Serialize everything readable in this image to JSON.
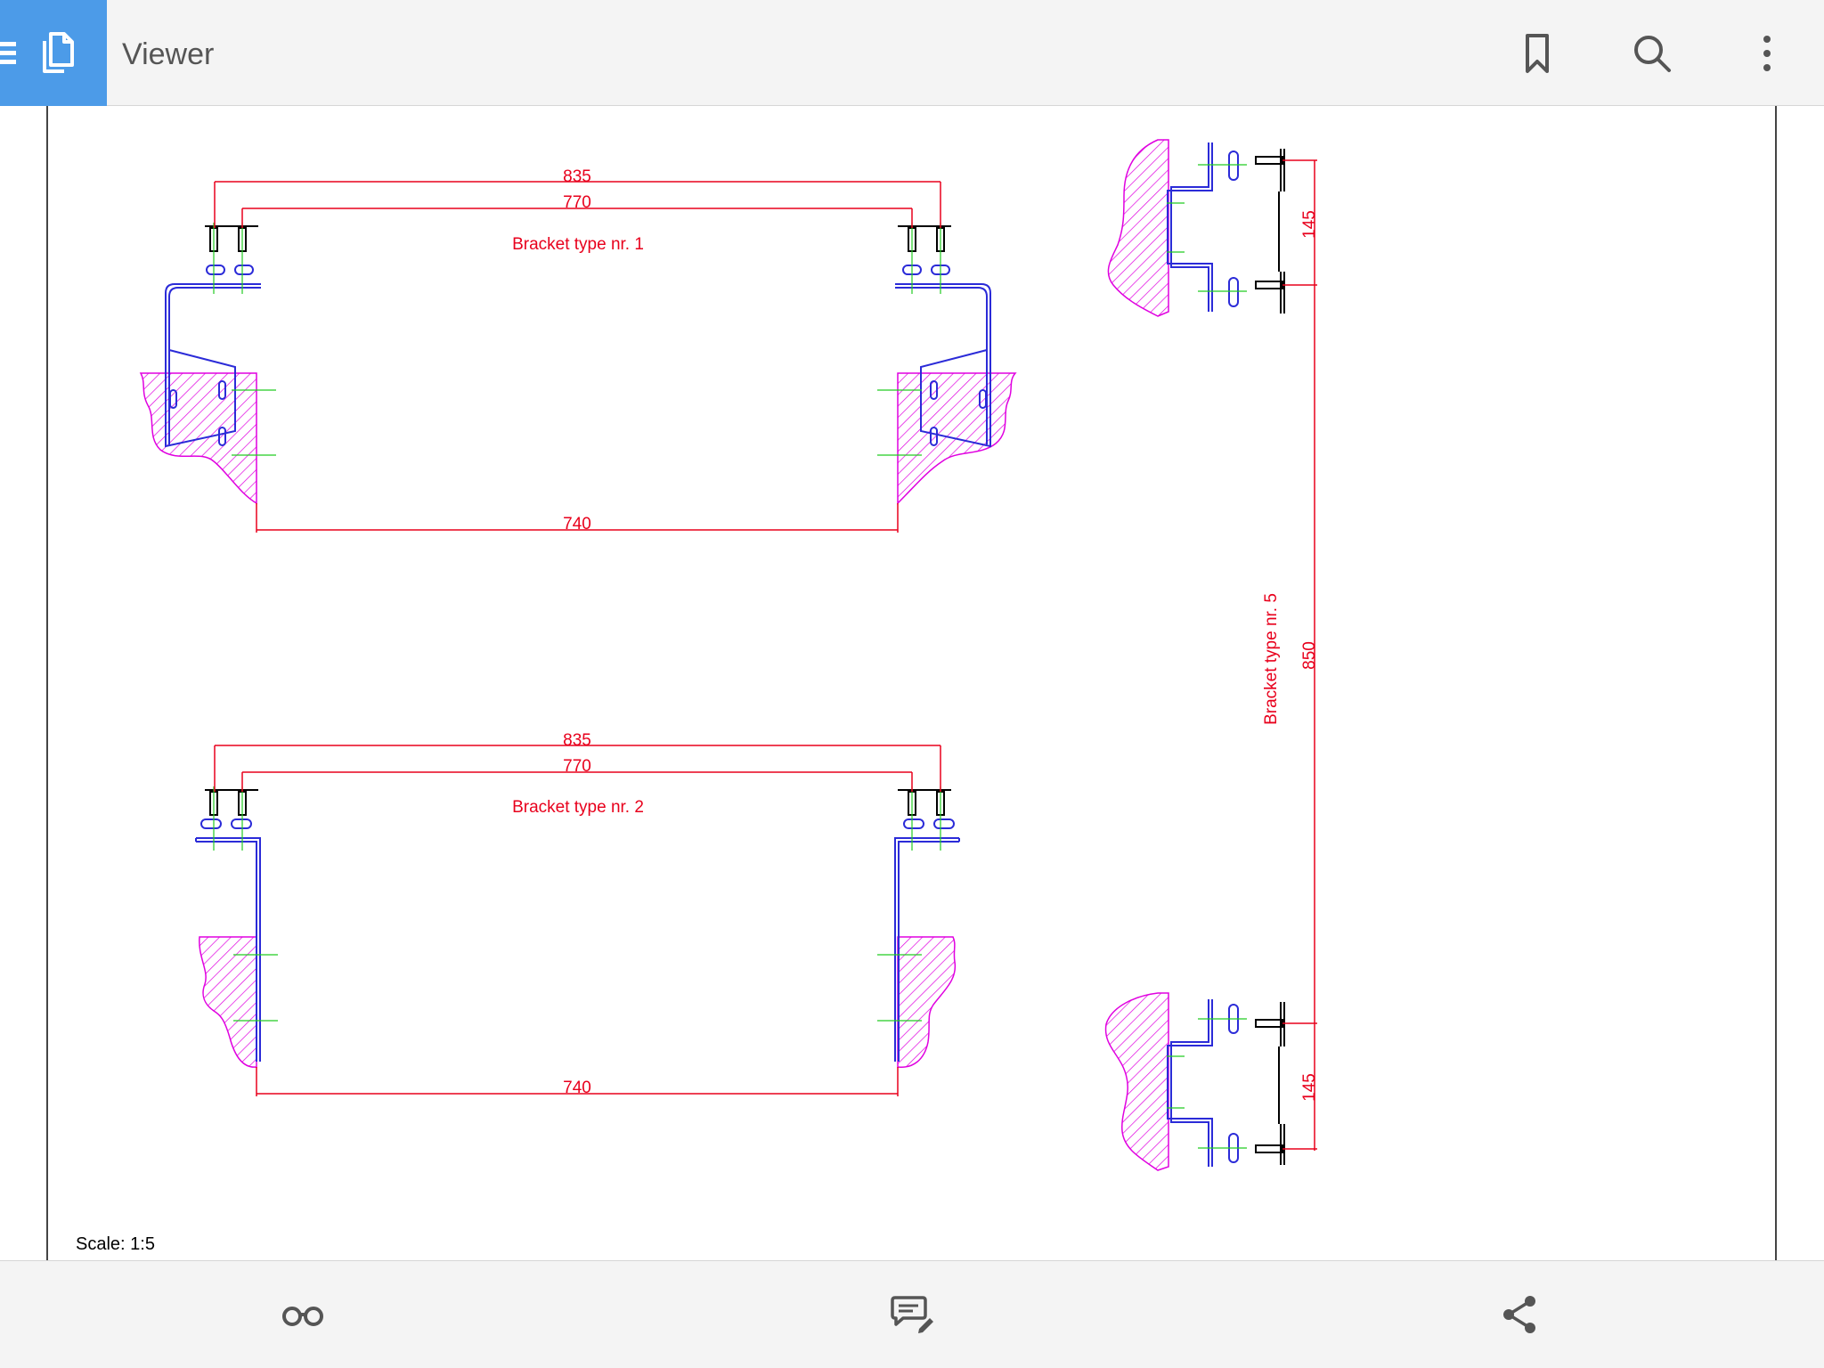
{
  "app": {
    "title": "Viewer"
  },
  "toolbar": {
    "menu_icon": "hamburger-icon",
    "doc_icon": "documents-icon",
    "bookmark_icon": "bookmark-icon",
    "search_icon": "search-icon",
    "more_icon": "more-vertical-icon"
  },
  "drawing": {
    "bracket1": {
      "label": "Bracket type nr. 1",
      "dim_outer": "835",
      "dim_inner": "770",
      "dim_bottom": "740"
    },
    "bracket2": {
      "label": "Bracket type nr. 2",
      "dim_outer": "835",
      "dim_inner": "770",
      "dim_bottom": "740"
    },
    "bracket5": {
      "label": "Bracket type nr. 5",
      "dim_top": "145",
      "dim_middle": "850",
      "dim_bottom": "145"
    },
    "scale": "Scale: 1:5",
    "colors": {
      "dimension": "#e8001c",
      "bracket": "#2b2bd8",
      "hatch": "#e000e0",
      "center": "#22cc22"
    }
  },
  "bottom_bar": {
    "reading_mode_icon": "glasses-icon",
    "comment_icon": "comment-edit-icon",
    "share_icon": "share-icon"
  }
}
